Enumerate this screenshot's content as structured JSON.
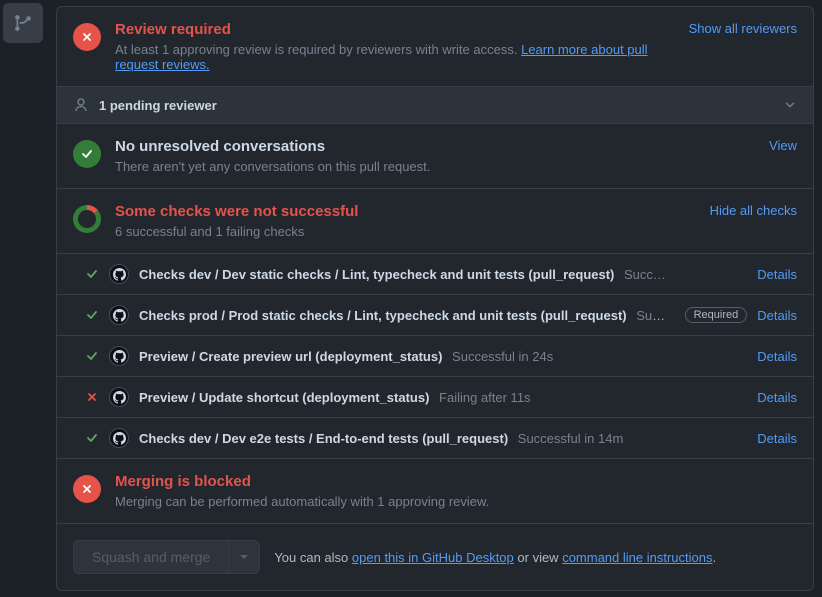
{
  "review": {
    "title": "Review required",
    "desc": "At least 1 approving review is required by reviewers with write access. ",
    "learn_more": "Learn more about pull request reviews.",
    "show_all": "Show all reviewers",
    "pending": "1 pending reviewer"
  },
  "conversations": {
    "title": "No unresolved conversations",
    "desc": "There aren't yet any conversations on this pull request.",
    "view": "View"
  },
  "checks": {
    "title": "Some checks were not successful",
    "summary": "6 successful and 1 failing checks",
    "hide_all": "Hide all checks",
    "required_label": "Required",
    "details_label": "Details",
    "items": [
      {
        "status": "pass",
        "name": "Checks dev / Dev static checks / Lint, typecheck and unit tests (pull_request)",
        "result": "Succ…",
        "required": false
      },
      {
        "status": "pass",
        "name": "Checks prod / Prod static checks / Lint, typecheck and unit tests (pull_request)",
        "result": "Suc…",
        "required": true
      },
      {
        "status": "pass",
        "name": "Preview / Create preview url (deployment_status)",
        "result": "Successful in 24s",
        "required": false
      },
      {
        "status": "fail",
        "name": "Preview / Update shortcut (deployment_status)",
        "result": "Failing after 11s",
        "required": false
      },
      {
        "status": "pass",
        "name": "Checks dev / Dev e2e tests / End-to-end tests (pull_request)",
        "result": "Successful in 14m",
        "required": false
      }
    ]
  },
  "merge": {
    "title": "Merging is blocked",
    "desc": "Merging can be performed automatically with 1 approving review."
  },
  "footer": {
    "button": "Squash and merge",
    "pre": "You can also ",
    "desktop": "open this in GitHub Desktop",
    "mid": " or view ",
    "cli": "command line instructions",
    "post": "."
  }
}
